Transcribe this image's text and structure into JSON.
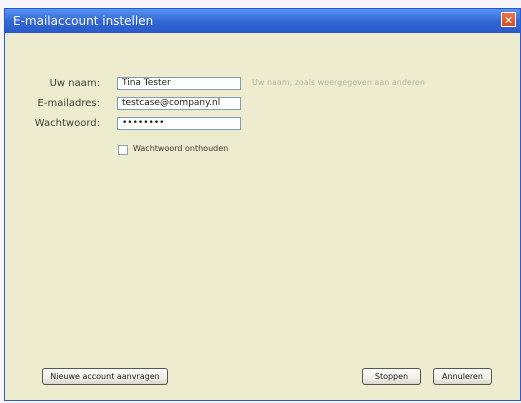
{
  "window": {
    "title": "E-mailaccount instellen",
    "close_symbol": "✕"
  },
  "form": {
    "name_label": "Uw naam:",
    "name_value": "Tina Tester",
    "name_hint": "Uw naam, zoals weergegeven aan anderen",
    "email_label": "E-mailadres:",
    "email_value": "testcase@company.nl",
    "password_label": "Wachtwoord:",
    "password_value": "••••••••",
    "remember_label": "Wachtwoord onthouden"
  },
  "buttons": {
    "new_account": "Nieuwe account aanvragen",
    "stop": "Stoppen",
    "cancel": "Annuleren"
  }
}
